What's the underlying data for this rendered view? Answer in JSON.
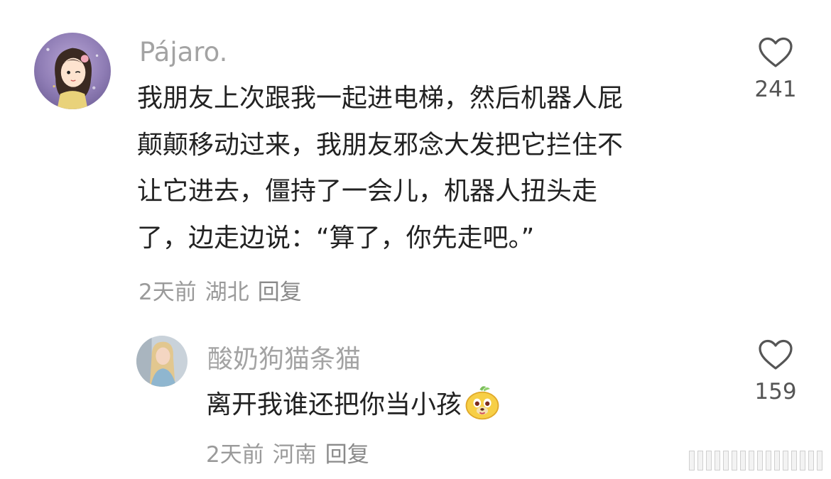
{
  "comment": {
    "username": "Pájaro.",
    "lines": [
      "我朋友上次跟我一起进电梯，然后机器人屁",
      "颠颠移动过来，我朋友邪念大发把它拦住不",
      "让它进去，僵持了一会儿，机器人扭头走",
      "了，边走边说：“算了，你先走吧。”"
    ],
    "time": "2天前",
    "location": "湖北",
    "reply_label": "回复",
    "like_icon": "heart-outline-icon",
    "like_count": "241"
  },
  "reply": {
    "username": "酸奶狗猫条猫",
    "text": "离开我谁还把你当小孩",
    "emoji": "dog-face-emoji",
    "time": "2天前",
    "location": "河南",
    "reply_label": "回复",
    "like_icon": "heart-outline-icon",
    "like_count": "159"
  },
  "colors": {
    "username": "#a3a3a3",
    "body_text": "#222222",
    "meta_text": "#9a9a9a",
    "like_count": "#555555"
  }
}
